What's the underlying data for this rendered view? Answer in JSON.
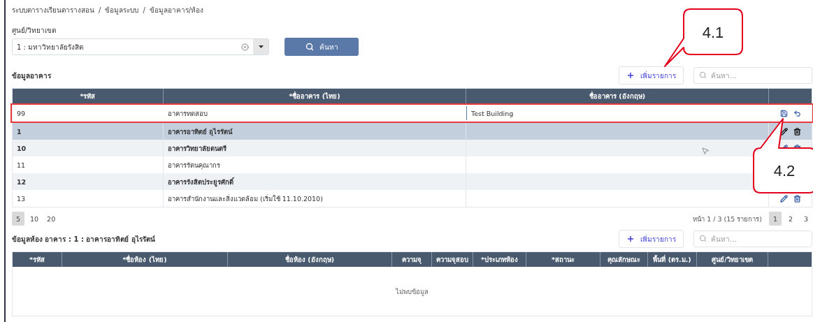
{
  "breadcrumb": {
    "separator": "/",
    "items": [
      "ระบบตารางเรียนตารางสอน",
      "ข้อมูลระบบ",
      "ข้อมูลอาคาร/ห้อง"
    ]
  },
  "campus": {
    "label": "ศูนย์/วิทยาเขต",
    "value": "1 : มหาวิทยาลัยรังสิต",
    "search_button": "ค้นหา"
  },
  "buildings": {
    "title": "ข้อมูลอาคาร",
    "add_button": "เพิ่มรายการ",
    "search_placeholder": "ค้นหา...",
    "columns": [
      "*รหัส",
      "*ชื่ออาคาร (ไทย)",
      "ชื่ออาคาร (อังกฤษ)"
    ],
    "edit_row": {
      "code": "99",
      "name_th": "อาคารทดสอบ",
      "name_en": "Test Building"
    },
    "rows": [
      {
        "code": "1",
        "name_th": "อาคารอาทิตย์ อุไรรัตน์",
        "selected": true,
        "emphasized": true
      },
      {
        "code": "10",
        "name_th": "อาคารวิทยาลัยดนตรี",
        "selected": false,
        "emphasized": true
      },
      {
        "code": "11",
        "name_th": "อาคารรัตนคุณากร",
        "selected": false,
        "emphasized": false
      },
      {
        "code": "12",
        "name_th": "อาคารรังสิตประยูรศักดิ์",
        "selected": false,
        "emphasized": true
      },
      {
        "code": "13",
        "name_th": "อาคารสำนักงานและสิ่งแวดล้อม (เริ่มใช้ 11.10.2010)",
        "selected": false,
        "emphasized": false
      }
    ],
    "page_sizes": [
      {
        "label": "5",
        "selected": true
      },
      {
        "label": "10",
        "selected": false
      },
      {
        "label": "20",
        "selected": false
      }
    ],
    "page_info": "หน้า 1 / 3 (15 รายการ)",
    "pages": [
      {
        "label": "1",
        "selected": true
      },
      {
        "label": "2",
        "selected": false
      },
      {
        "label": "3",
        "selected": false
      }
    ]
  },
  "rooms": {
    "title": "ข้อมูลห้อง อาคาร : 1 : อาคารอาทิตย์ อุไรรัตน์",
    "add_button": "เพิ่มรายการ",
    "search_placeholder": "ค้นหา...",
    "columns": [
      "*รหัส",
      "*ชื่อห้อง (ไทย)",
      "ชื่อห้อง (อังกฤษ)",
      "ความจุ",
      "ความจุสอบ",
      "*ประเภทห้อง",
      "*สถานะ",
      "คุณลักษณะ",
      "พื้นที่ (ตร.ม.)",
      "ศูนย์/วิทยาเขต"
    ],
    "empty": "ไม่พบข้อมูล"
  },
  "callouts": [
    {
      "label": "4.1"
    },
    {
      "label": "4.2"
    }
  ]
}
